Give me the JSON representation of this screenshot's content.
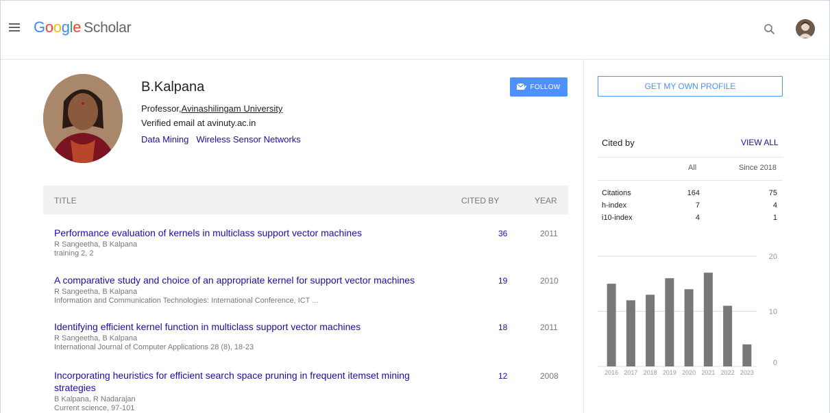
{
  "header": {
    "logo": {
      "g": "G",
      "o1": "o",
      "o2": "o",
      "g2": "g",
      "l": "l",
      "e": "e",
      "product": "Scholar"
    },
    "menu_icon": "hamburger-menu-icon",
    "search_icon": "search-icon",
    "account_icon": "avatar-icon"
  },
  "profile": {
    "name": "B.Kalpana",
    "position_prefix": "Professor,",
    "institution": "Avinashilingam University",
    "email": "Verified email at avinuty.ac.in",
    "interests": [
      "Data Mining",
      "Wireless Sensor Networks"
    ],
    "follow_label": "FOLLOW"
  },
  "articles": {
    "columns": {
      "title": "TITLE",
      "cited_by": "CITED BY",
      "year": "YEAR"
    },
    "rows": [
      {
        "title": "Performance evaluation of kernels in multiclass support vector machines",
        "authors": "R Sangeetha, B Kalpana",
        "venue": "training 2, 2",
        "cited": "36",
        "year": "2011"
      },
      {
        "title": "A comparative study and choice of an appropriate kernel for support vector machines",
        "authors": "R Sangeetha, B Kalpana",
        "venue": "Information and Communication Technologies: International Conference, ICT ...",
        "cited": "19",
        "year": "2010"
      },
      {
        "title": "Identifying efficient kernel function in multiclass support vector machines",
        "authors": "R Sangeetha, B Kalpana",
        "venue": "International Journal of Computer Applications 28 (8), 18-23",
        "cited": "18",
        "year": "2011"
      },
      {
        "title": "Incorporating heuristics for efficient search space pruning in frequent itemset mining strategies",
        "authors": "B Kalpana, R Nadarajan",
        "venue": "Current science, 97-101",
        "cited": "12",
        "year": "2008"
      }
    ]
  },
  "sidebar": {
    "get_profile_label": "GET MY OWN PROFILE",
    "cited_by_title": "Cited by",
    "view_all_label": "VIEW ALL",
    "col_all": "All",
    "col_since": "Since 2018",
    "stats": [
      {
        "label": "Citations",
        "all": "164",
        "since": "75"
      },
      {
        "label": "h-index",
        "all": "7",
        "since": "4"
      },
      {
        "label": "i10-index",
        "all": "4",
        "since": "1"
      }
    ]
  },
  "chart_data": {
    "type": "bar",
    "categories": [
      "2016",
      "2017",
      "2018",
      "2019",
      "2020",
      "2021",
      "2022",
      "2023"
    ],
    "values": [
      15,
      12,
      13,
      16,
      14,
      17,
      11,
      4
    ],
    "ylim": [
      0,
      20
    ],
    "yticks": [
      "20",
      "10",
      "0"
    ],
    "grid": true,
    "bar_color": "#777777"
  }
}
